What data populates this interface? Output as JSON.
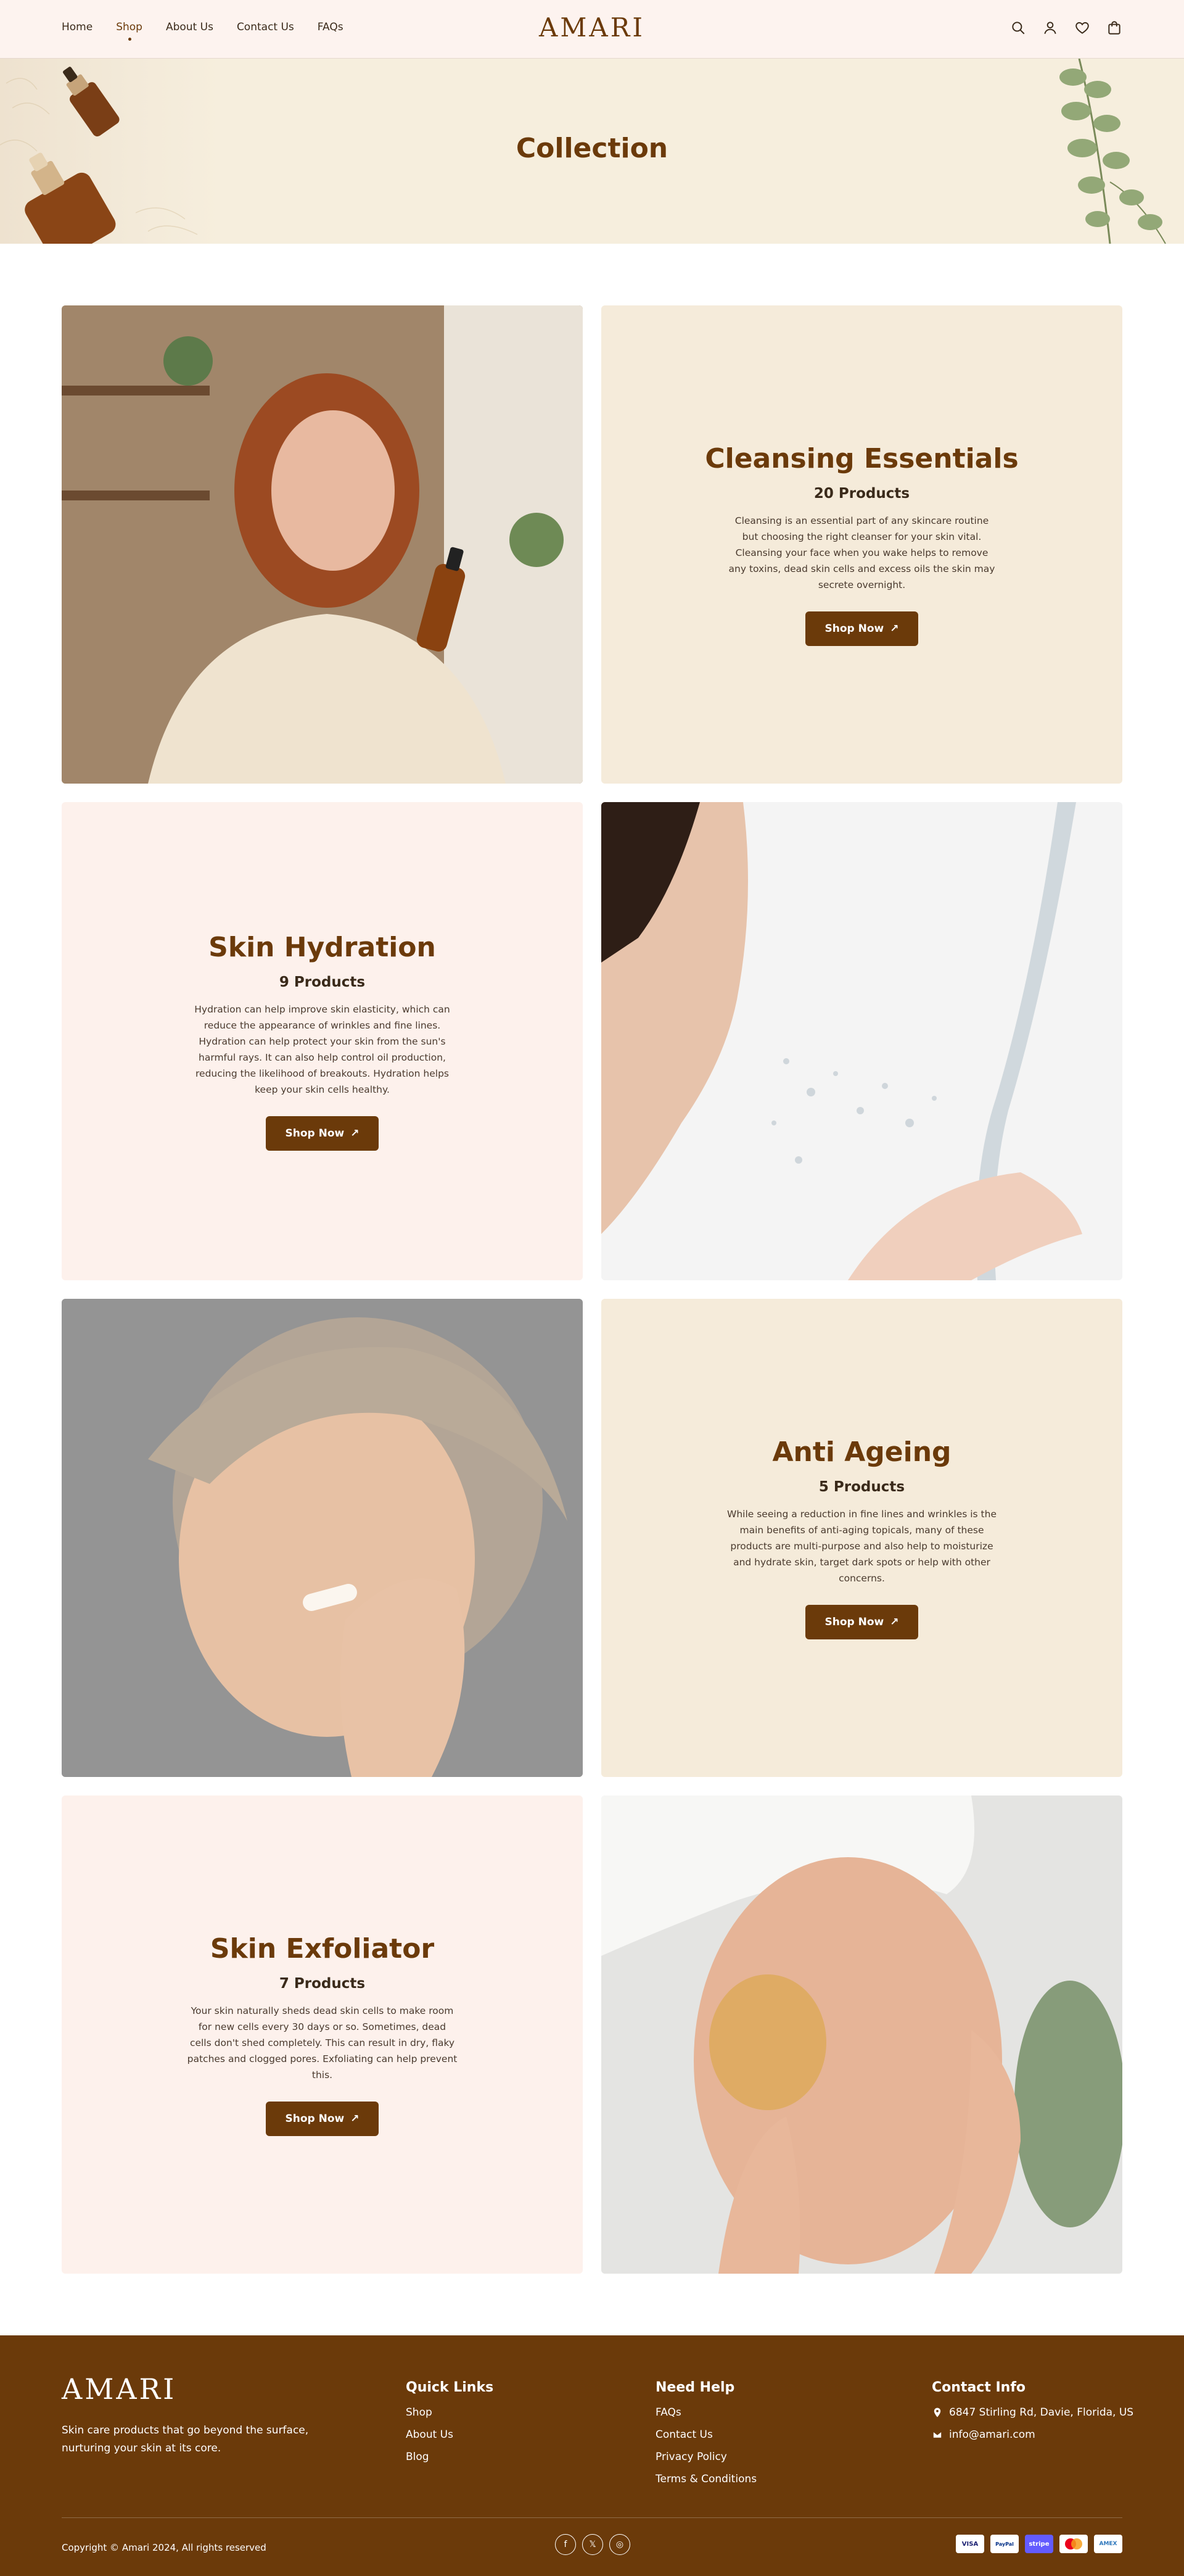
{
  "header": {
    "nav": [
      "Home",
      "Shop",
      "About Us",
      "Contact Us",
      "FAQs"
    ],
    "active_nav": "Shop",
    "logo": "AMARI",
    "icons": [
      "search-icon",
      "user-icon",
      "heart-icon",
      "bag-icon"
    ]
  },
  "hero": {
    "title": "Collection"
  },
  "collections": [
    {
      "title": "Cleansing Essentials",
      "count": "20 Products",
      "description": "Cleansing is an essential part of any skincare routine but choosing the right cleanser for your skin vital. Cleansing your face when you wake helps to remove any toxins, dead skin cells and excess oils the skin may secrete overnight.",
      "button": "Shop Now"
    },
    {
      "title": "Skin Hydration",
      "count": "9 Products",
      "description": "Hydration can help improve skin elasticity, which can reduce the appearance of wrinkles and fine lines. Hydration can help protect your skin from the sun's harmful rays. It can also help control oil production, reducing the likelihood of breakouts. Hydration helps keep your skin cells healthy.",
      "button": "Shop Now"
    },
    {
      "title": "Anti Ageing",
      "count": "5 Products",
      "description": "While seeing a reduction in fine lines and wrinkles is the main benefits of anti-aging topicals, many of these products are multi-purpose and also help to moisturize and hydrate skin, target dark spots or help with other concerns.",
      "button": "Shop Now"
    },
    {
      "title": "Skin Exfoliator",
      "count": "7 Products",
      "description": "Your skin naturally sheds dead skin cells to make room for new cells every 30 days or so. Sometimes, dead cells don't shed completely. This can result in dry, flaky patches and clogged pores. Exfoliating can help prevent this.",
      "button": "Shop Now"
    }
  ],
  "footer": {
    "logo": "AMARI",
    "tagline": "Skin care products that go beyond the surface, nurturing your skin at its core.",
    "quick_links": {
      "title": "Quick Links",
      "items": [
        "Shop",
        "About Us",
        "Blog"
      ]
    },
    "need_help": {
      "title": "Need Help",
      "items": [
        "FAQs",
        "Contact Us",
        "Privacy Policy",
        "Terms & Conditions"
      ]
    },
    "contact": {
      "title": "Contact Info",
      "address": "6847 Stirling Rd, Davie, Florida, US",
      "email": "info@amari.com"
    },
    "copyright": "Copyright © Amari 2024, All rights reserved",
    "social": [
      "facebook-icon",
      "x-icon",
      "instagram-icon"
    ],
    "payments": [
      "VISA",
      "PayPal",
      "stripe",
      "mastercard",
      "AMEX"
    ]
  },
  "colors": {
    "brand": "#6b3a0a",
    "beige": "#f5ebda",
    "pink": "#fdf1ec",
    "header_bg": "#fdf3ef"
  }
}
